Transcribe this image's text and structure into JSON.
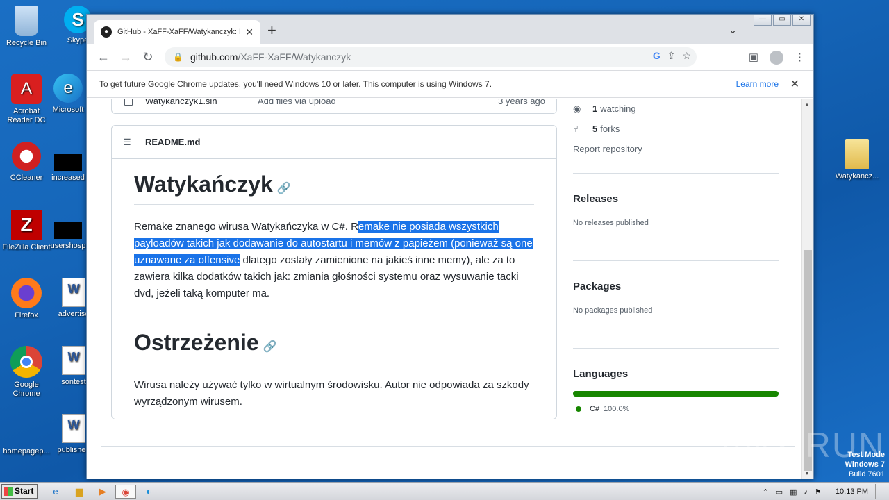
{
  "desktop": {
    "icons": [
      {
        "label": "Recycle Bin",
        "glyph": "🗑"
      },
      {
        "label": "Skype",
        "glyph": "S"
      },
      {
        "label": "Acrobat Reader DC",
        "glyph": "A"
      },
      {
        "label": "Microsoft",
        "glyph": "e"
      },
      {
        "label": "CCleaner",
        "glyph": "C"
      },
      {
        "label": "increased",
        "glyph": ""
      },
      {
        "label": "FileZilla Client",
        "glyph": "Z"
      },
      {
        "label": "usershosp",
        "glyph": ""
      },
      {
        "label": "Firefox",
        "glyph": "🦊"
      },
      {
        "label": "advertise",
        "glyph": "W"
      },
      {
        "label": "Google Chrome",
        "glyph": "◉"
      },
      {
        "label": "sontest",
        "glyph": "W"
      },
      {
        "label": "homepagep...",
        "glyph": ""
      },
      {
        "label": "published",
        "glyph": "W"
      },
      {
        "label": "Watykancz...",
        "glyph": "📁"
      }
    ]
  },
  "browser": {
    "tab_title": "GitHub - XaFF-XaFF/Watykanczyk: R",
    "url_domain": "github.com",
    "url_path": "/XaFF-XaFF/Watykanczyk",
    "infobar_text": "To get future Google Chrome updates, you'll need Windows 10 or later. This computer is using Windows 7.",
    "infobar_link": "Learn more"
  },
  "repo": {
    "file_name": "Watykanczyk1.sln",
    "file_message": "Add files via upload",
    "file_age": "3 years ago",
    "readme_label": "README.md",
    "h1": "Watykańczyk",
    "p1_before": "Remake znanego wirusa Watykańczyka w C#. R",
    "p1_highlight": "emake nie posiada wszystkich payloadów takich jak dodawanie do autostartu i memów z papieżem (ponieważ są one uznawane za offensive",
    "p1_after": " dlatego zostały zamienione na jakieś inne memy), ale za to zawiera kilka dodatków takich jak: zmiania głośności systemu oraz wysuwanie tacki dvd, jeżeli taką komputer ma.",
    "h2": "Ostrzeżenie",
    "p2": "Wirusa należy używać tylko w wirtualnym środowisku. Autor nie odpowiada za szkody wyrządzonym wirusem."
  },
  "sidebar": {
    "watching_count": "1",
    "watching_label": "watching",
    "forks_count": "5",
    "forks_label": "forks",
    "report": "Report repository",
    "releases_title": "Releases",
    "releases_text": "No releases published",
    "packages_title": "Packages",
    "packages_text": "No packages published",
    "languages_title": "Languages",
    "language_name": "C#",
    "language_pct": "100.0%",
    "language_share": 1.0,
    "language_color": "#178600"
  },
  "watermark": "ANY RUN",
  "testmode": {
    "line1": "Test Mode",
    "line2": "Windows 7",
    "line3": "Build 7601"
  },
  "taskbar": {
    "start": "Start",
    "clock": "10:13 PM"
  }
}
